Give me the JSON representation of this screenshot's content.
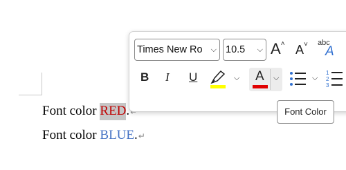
{
  "document": {
    "line1_prefix": "Font color ",
    "line1_word": "RED",
    "line1_suffix": ".",
    "line2_prefix": "Font color ",
    "line2_word": "BLUE",
    "line2_suffix": ".",
    "paragraph_mark": "↵"
  },
  "toolbar": {
    "font_name": "Times New Ro",
    "font_size": "10.5",
    "grow_font_label": "A",
    "shrink_font_label": "A",
    "change_case_label": "abc",
    "change_case_A": "A",
    "bold_label": "B",
    "italic_label": "I",
    "underline_label": "U",
    "font_color_label": "A",
    "highlight_color": "#ffff00",
    "font_color": "#e00000"
  },
  "tooltip": {
    "text": "Font Color"
  },
  "colors": {
    "red_text": "#c00000",
    "blue_text": "#4472c4",
    "selection": "#c6c6c6",
    "list_accent": "#2f6fd0"
  },
  "icons": {
    "grow": "grow-font-icon",
    "shrink": "shrink-font-icon",
    "highlighter": "highlighter-icon",
    "bullets": "bullet-list-icon",
    "numbering": "numbered-list-icon",
    "chevron": "chevron-down-icon"
  }
}
